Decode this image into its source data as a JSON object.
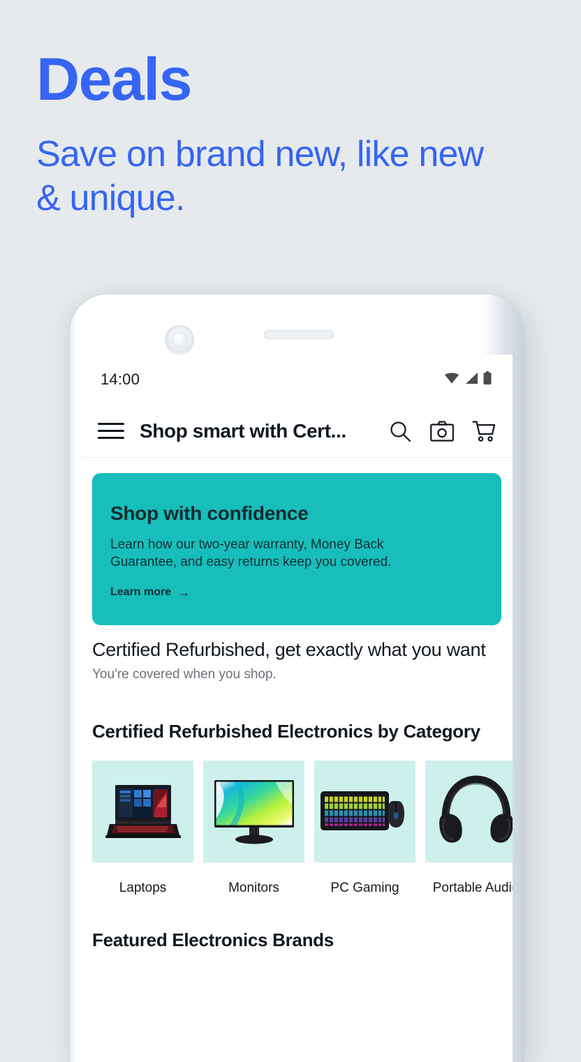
{
  "promo": {
    "title": "Deals",
    "subtitle": "Save on brand new, like new & unique.",
    "accent_color": "#3665f3"
  },
  "phone": {
    "status_bar": {
      "time": "14:00",
      "icons": [
        "wifi-icon",
        "cellular-signal-icon",
        "battery-icon"
      ]
    },
    "app_bar": {
      "menu_icon": "hamburger-menu-icon",
      "title": "Shop smart with Cert...",
      "actions": [
        {
          "name": "search-icon",
          "label": "Search"
        },
        {
          "name": "camera-icon",
          "label": "Image search"
        },
        {
          "name": "cart-icon",
          "label": "Cart"
        }
      ]
    },
    "banner": {
      "title": "Shop with confidence",
      "text": "Learn how our two-year warranty, Money Back Guarantee, and easy returns keep you covered.",
      "link_label": "Learn more",
      "link_arrow": "→",
      "background_color": "#17bebb"
    },
    "intro": {
      "heading": "Certified Refurbished, get exactly what you want",
      "subheading": "You're covered when you shop."
    },
    "category_section": {
      "heading": "Certified Refurbished Electronics by Category",
      "tile_background": "#cdf0ec",
      "items": [
        {
          "label": "Laptops",
          "image": "laptop-thumbnail"
        },
        {
          "label": "Monitors",
          "image": "monitor-thumbnail"
        },
        {
          "label": "PC Gaming",
          "image": "keyboard-mouse-thumbnail"
        },
        {
          "label": "Portable Audio",
          "image": "headphones-thumbnail"
        }
      ]
    },
    "brands_section": {
      "heading": "Featured Electronics Brands"
    }
  }
}
